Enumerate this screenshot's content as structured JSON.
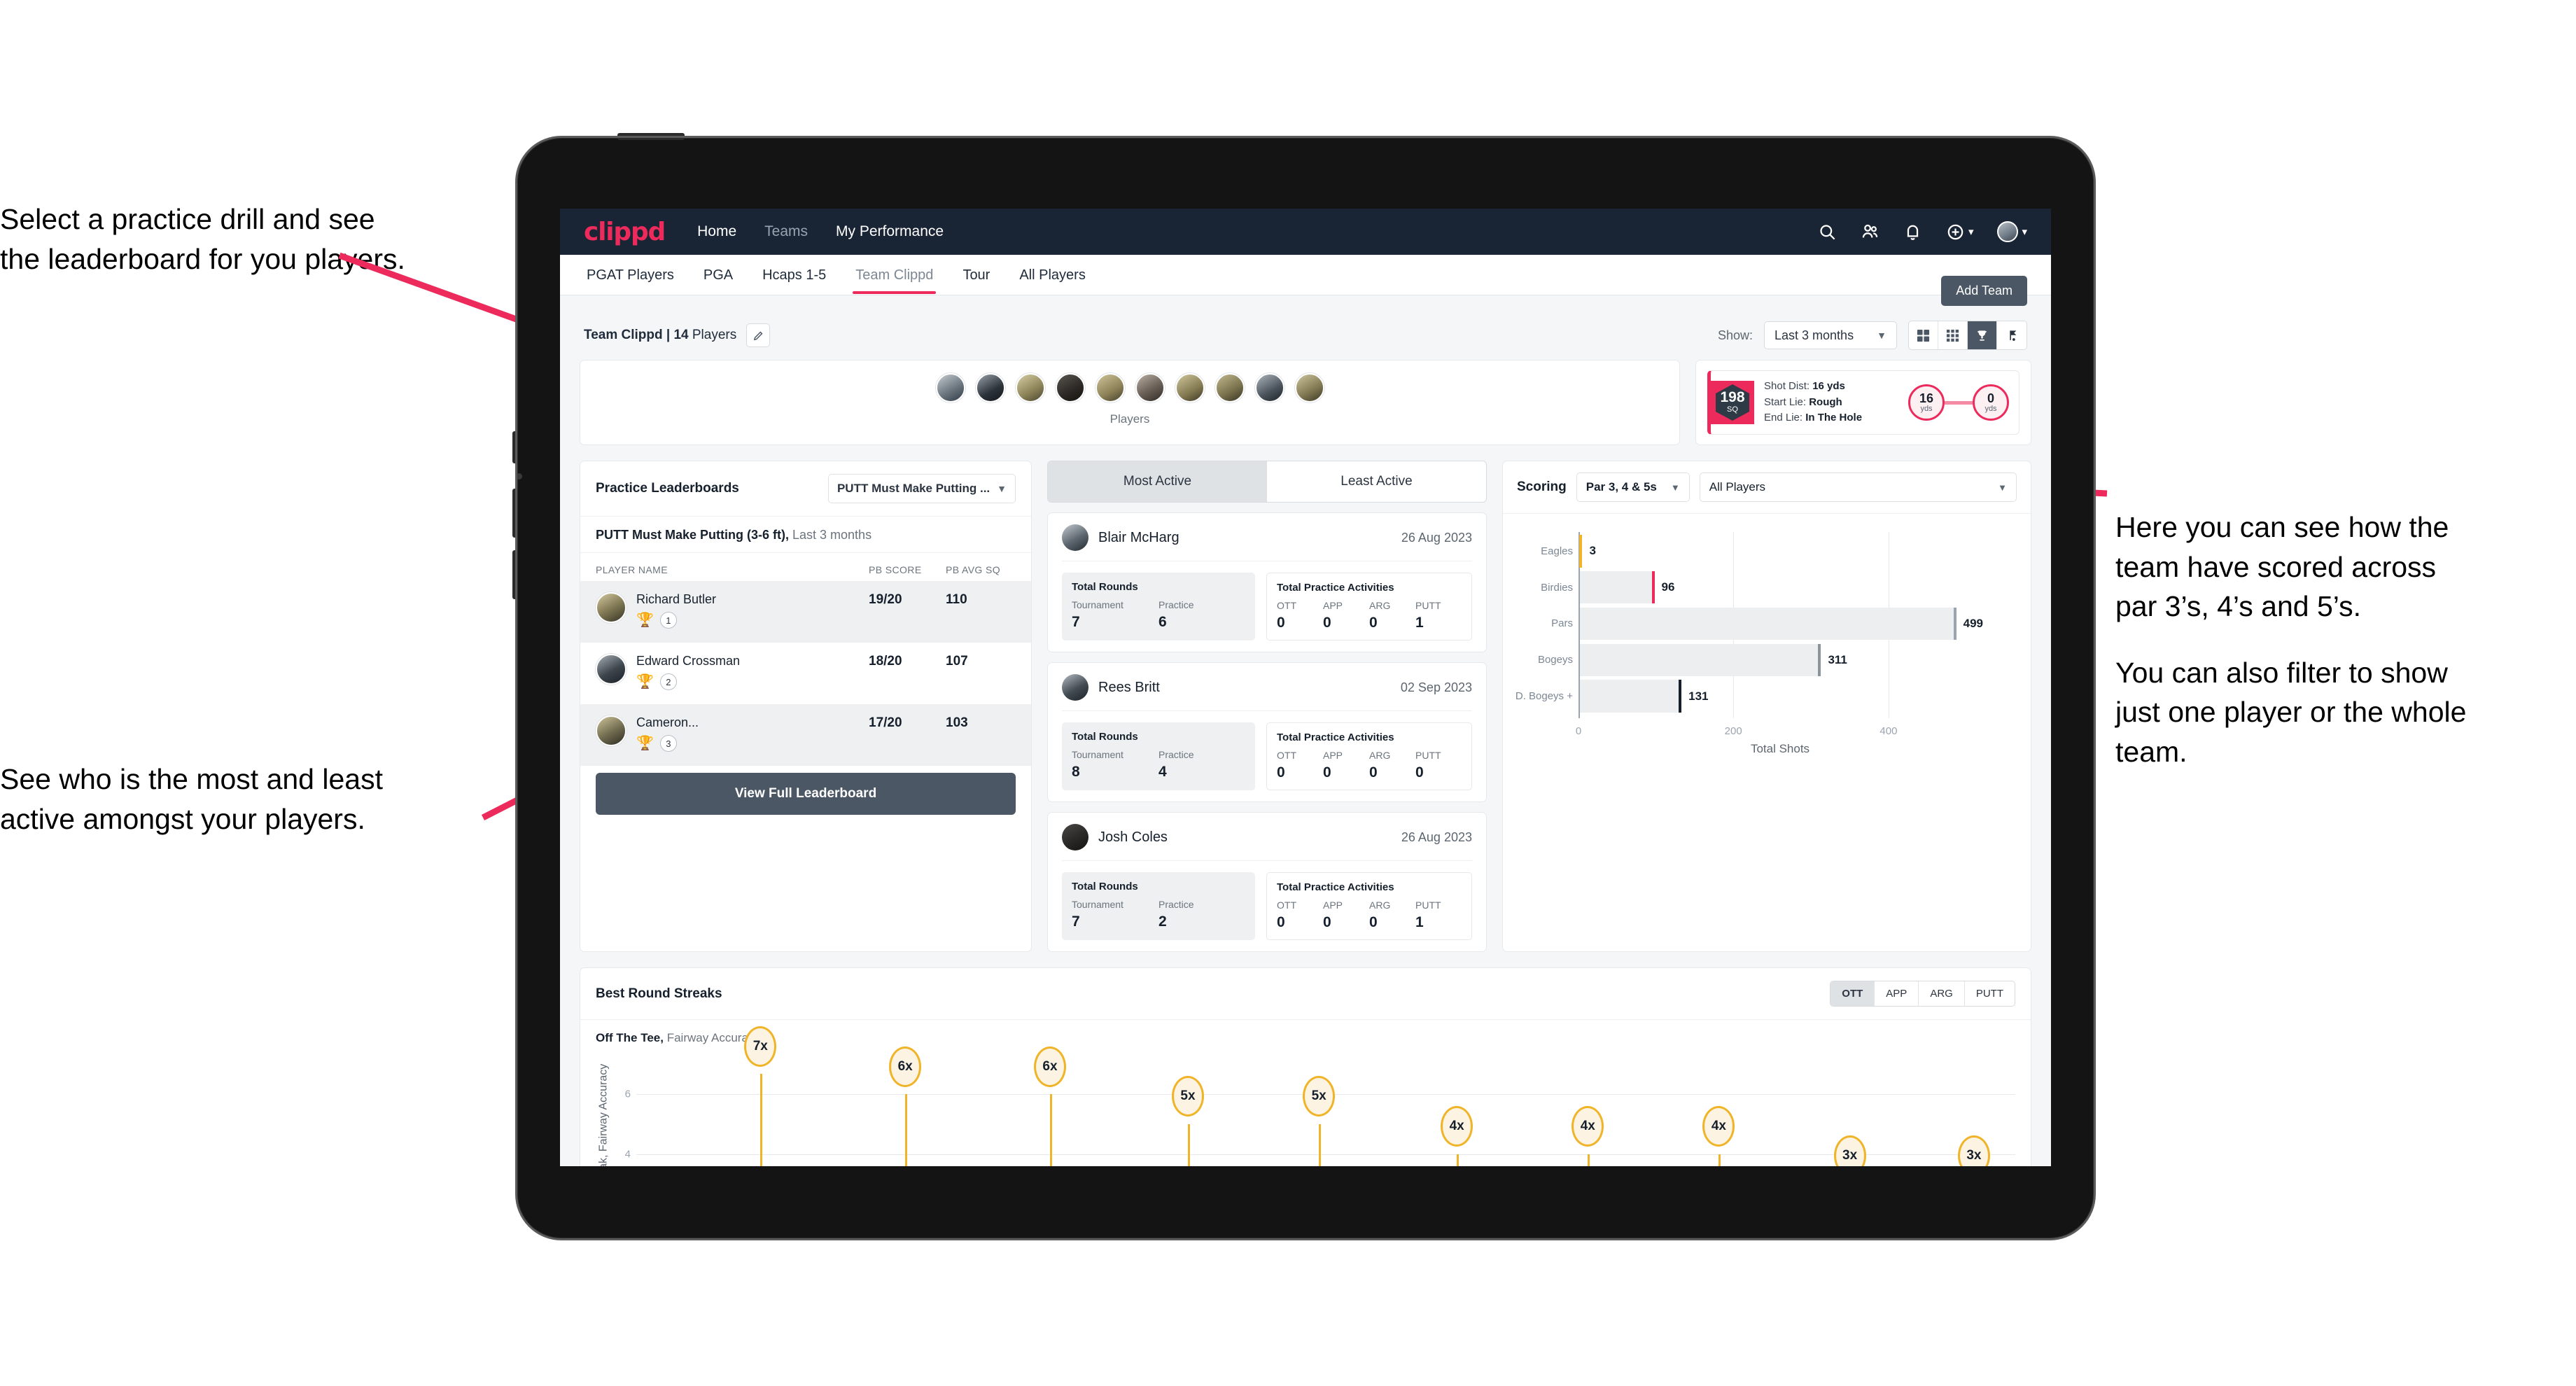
{
  "annotations": {
    "left_top": [
      "Select a practice drill and see",
      "the leaderboard for you players."
    ],
    "left_bottom": [
      "See who is the most and least",
      "active amongst your players."
    ],
    "right": {
      "p1": [
        "Here you can see how the",
        "team have scored across",
        "par 3’s, 4’s and 5’s."
      ],
      "p2": [
        "You can also filter to show",
        "just one player or the whole",
        "team."
      ]
    }
  },
  "header": {
    "logo": "clippd",
    "nav": [
      {
        "label": "Home",
        "dim": false
      },
      {
        "label": "Teams",
        "dim": true
      },
      {
        "label": "My Performance",
        "dim": false
      }
    ],
    "icons": [
      "search-icon",
      "people-icon",
      "bell-icon",
      "plus-circle-icon",
      "avatar"
    ]
  },
  "tabs": {
    "items": [
      {
        "label": "PGAT Players",
        "active": false
      },
      {
        "label": "PGA",
        "active": false
      },
      {
        "label": "Hcaps 1-5",
        "active": false
      },
      {
        "label": "Team Clippd",
        "active": true
      },
      {
        "label": "Tour",
        "active": false
      },
      {
        "label": "All Players",
        "active": false
      }
    ],
    "add_team": "Add Team"
  },
  "toolbar": {
    "team_name": "Team Clippd | 14",
    "team_suffix": " Players",
    "edit_icon": "pencil-icon",
    "show_label": "Show:",
    "range_value": "Last 3 months",
    "view_modes": [
      "grid-large-icon",
      "grid-small-icon",
      "trophy-icon",
      "flag-icon"
    ],
    "active_view": 2
  },
  "players_panel": {
    "caption": "Players",
    "avatar_count": 10
  },
  "shot_panel": {
    "sq_value": "198",
    "sq_unit": "SQ",
    "lines": [
      {
        "k": "Shot Dist:",
        "v": "16 yds"
      },
      {
        "k": "Start Lie:",
        "v": "Rough"
      },
      {
        "k": "End Lie:",
        "v": "In The Hole"
      }
    ],
    "start_dist": {
      "v": "16",
      "u": "yds"
    },
    "end_dist": {
      "v": "0",
      "u": "yds"
    }
  },
  "leaderboard": {
    "title": "Practice Leaderboards",
    "drill_select": "PUTT Must Make Putting ...",
    "subtitle_bold": "PUTT Must Make Putting (3-6 ft),",
    "subtitle_rest": " Last 3 months",
    "columns": [
      "PLAYER NAME",
      "PB SCORE",
      "PB AVG SQ"
    ],
    "rows": [
      {
        "name": "Richard Butler",
        "score": "19/20",
        "sq": "110",
        "rank": "1",
        "trophy": "gold"
      },
      {
        "name": "Edward Crossman",
        "score": "18/20",
        "sq": "107",
        "rank": "2",
        "trophy": "silver"
      },
      {
        "name": "Cameron...",
        "score": "17/20",
        "sq": "103",
        "rank": "3",
        "trophy": "bronze"
      }
    ],
    "button": "View Full Leaderboard"
  },
  "activity": {
    "tabs": [
      {
        "label": "Most Active",
        "active": true
      },
      {
        "label": "Least Active",
        "active": false
      }
    ],
    "rounds_title": "Total Rounds",
    "practice_title": "Total Practice Activities",
    "rounds_keys": [
      "Tournament",
      "Practice"
    ],
    "practice_keys": [
      "OTT",
      "APP",
      "ARG",
      "PUTT"
    ],
    "cards": [
      {
        "name": "Blair McHarg",
        "date": "26 Aug 2023",
        "rounds": [
          "7",
          "6"
        ],
        "practice": [
          "0",
          "0",
          "0",
          "1"
        ]
      },
      {
        "name": "Rees Britt",
        "date": "02 Sep 2023",
        "rounds": [
          "8",
          "4"
        ],
        "practice": [
          "0",
          "0",
          "0",
          "0"
        ]
      },
      {
        "name": "Josh Coles",
        "date": "26 Aug 2023",
        "rounds": [
          "7",
          "2"
        ],
        "practice": [
          "0",
          "0",
          "0",
          "1"
        ]
      }
    ]
  },
  "scoring": {
    "title": "Scoring",
    "par_filter": "Par 3, 4 & 5s",
    "player_filter": "All Players",
    "chart_data": {
      "type": "bar",
      "orientation": "horizontal",
      "title": "Scoring",
      "categories": [
        "Eagles",
        "Birdies",
        "Pars",
        "Bogeys",
        "D. Bogeys +"
      ],
      "values": [
        3,
        96,
        499,
        311,
        131
      ],
      "cap_colors": [
        "#f0b429",
        "#ec2a5b",
        "#9aa4b1",
        "#8b949d",
        "#16202c"
      ],
      "xlabel": "Total Shots",
      "ylabel": "",
      "xlim": [
        0,
        520
      ],
      "xticks": [
        0,
        200,
        400
      ],
      "grid": true,
      "legend": "none"
    }
  },
  "streaks": {
    "title": "Best Round Streaks",
    "segments": [
      {
        "label": "OTT",
        "active": true
      },
      {
        "label": "APP",
        "active": false
      },
      {
        "label": "ARG",
        "active": false
      },
      {
        "label": "PUTT",
        "active": false
      }
    ],
    "sub_bold": "Off The Tee,",
    "sub_rest": " Fairway Accuracy",
    "chart_data": {
      "type": "scatter",
      "title": "Best Round Streaks",
      "subtitle": "Off The Tee, Fairway Accuracy",
      "ylabel": "Streak, Fairway Accuracy",
      "xlabel": "",
      "yticks": [
        4,
        6
      ],
      "ylim": [
        0,
        8
      ],
      "labels": [
        "7x",
        "6x",
        "6x",
        "5x",
        "5x",
        "4x",
        "4x",
        "4x",
        "3x",
        "3x"
      ],
      "values": [
        7,
        6,
        6,
        5,
        5,
        4,
        4,
        4,
        3,
        3
      ],
      "x_positions": [
        10,
        21,
        32,
        43,
        54,
        65,
        76,
        87,
        98,
        109
      ]
    }
  }
}
